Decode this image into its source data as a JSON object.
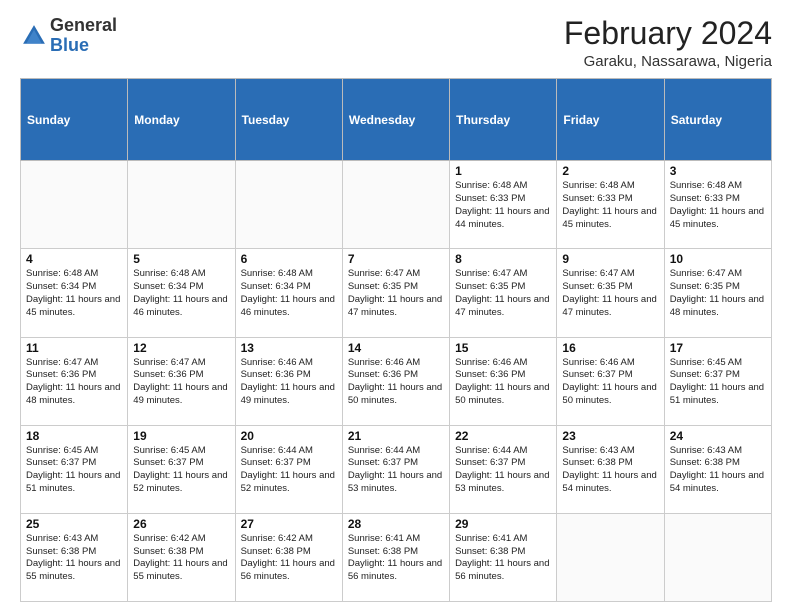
{
  "header": {
    "logo_general": "General",
    "logo_blue": "Blue",
    "month_year": "February 2024",
    "location": "Garaku, Nassarawa, Nigeria"
  },
  "days_of_week": [
    "Sunday",
    "Monday",
    "Tuesday",
    "Wednesday",
    "Thursday",
    "Friday",
    "Saturday"
  ],
  "weeks": [
    [
      {
        "num": "",
        "info": ""
      },
      {
        "num": "",
        "info": ""
      },
      {
        "num": "",
        "info": ""
      },
      {
        "num": "",
        "info": ""
      },
      {
        "num": "1",
        "info": "Sunrise: 6:48 AM\nSunset: 6:33 PM\nDaylight: 11 hours\nand 44 minutes."
      },
      {
        "num": "2",
        "info": "Sunrise: 6:48 AM\nSunset: 6:33 PM\nDaylight: 11 hours\nand 45 minutes."
      },
      {
        "num": "3",
        "info": "Sunrise: 6:48 AM\nSunset: 6:33 PM\nDaylight: 11 hours\nand 45 minutes."
      }
    ],
    [
      {
        "num": "4",
        "info": "Sunrise: 6:48 AM\nSunset: 6:34 PM\nDaylight: 11 hours\nand 45 minutes."
      },
      {
        "num": "5",
        "info": "Sunrise: 6:48 AM\nSunset: 6:34 PM\nDaylight: 11 hours\nand 46 minutes."
      },
      {
        "num": "6",
        "info": "Sunrise: 6:48 AM\nSunset: 6:34 PM\nDaylight: 11 hours\nand 46 minutes."
      },
      {
        "num": "7",
        "info": "Sunrise: 6:47 AM\nSunset: 6:35 PM\nDaylight: 11 hours\nand 47 minutes."
      },
      {
        "num": "8",
        "info": "Sunrise: 6:47 AM\nSunset: 6:35 PM\nDaylight: 11 hours\nand 47 minutes."
      },
      {
        "num": "9",
        "info": "Sunrise: 6:47 AM\nSunset: 6:35 PM\nDaylight: 11 hours\nand 47 minutes."
      },
      {
        "num": "10",
        "info": "Sunrise: 6:47 AM\nSunset: 6:35 PM\nDaylight: 11 hours\nand 48 minutes."
      }
    ],
    [
      {
        "num": "11",
        "info": "Sunrise: 6:47 AM\nSunset: 6:36 PM\nDaylight: 11 hours\nand 48 minutes."
      },
      {
        "num": "12",
        "info": "Sunrise: 6:47 AM\nSunset: 6:36 PM\nDaylight: 11 hours\nand 49 minutes."
      },
      {
        "num": "13",
        "info": "Sunrise: 6:46 AM\nSunset: 6:36 PM\nDaylight: 11 hours\nand 49 minutes."
      },
      {
        "num": "14",
        "info": "Sunrise: 6:46 AM\nSunset: 6:36 PM\nDaylight: 11 hours\nand 50 minutes."
      },
      {
        "num": "15",
        "info": "Sunrise: 6:46 AM\nSunset: 6:36 PM\nDaylight: 11 hours\nand 50 minutes."
      },
      {
        "num": "16",
        "info": "Sunrise: 6:46 AM\nSunset: 6:37 PM\nDaylight: 11 hours\nand 50 minutes."
      },
      {
        "num": "17",
        "info": "Sunrise: 6:45 AM\nSunset: 6:37 PM\nDaylight: 11 hours\nand 51 minutes."
      }
    ],
    [
      {
        "num": "18",
        "info": "Sunrise: 6:45 AM\nSunset: 6:37 PM\nDaylight: 11 hours\nand 51 minutes."
      },
      {
        "num": "19",
        "info": "Sunrise: 6:45 AM\nSunset: 6:37 PM\nDaylight: 11 hours\nand 52 minutes."
      },
      {
        "num": "20",
        "info": "Sunrise: 6:44 AM\nSunset: 6:37 PM\nDaylight: 11 hours\nand 52 minutes."
      },
      {
        "num": "21",
        "info": "Sunrise: 6:44 AM\nSunset: 6:37 PM\nDaylight: 11 hours\nand 53 minutes."
      },
      {
        "num": "22",
        "info": "Sunrise: 6:44 AM\nSunset: 6:37 PM\nDaylight: 11 hours\nand 53 minutes."
      },
      {
        "num": "23",
        "info": "Sunrise: 6:43 AM\nSunset: 6:38 PM\nDaylight: 11 hours\nand 54 minutes."
      },
      {
        "num": "24",
        "info": "Sunrise: 6:43 AM\nSunset: 6:38 PM\nDaylight: 11 hours\nand 54 minutes."
      }
    ],
    [
      {
        "num": "25",
        "info": "Sunrise: 6:43 AM\nSunset: 6:38 PM\nDaylight: 11 hours\nand 55 minutes."
      },
      {
        "num": "26",
        "info": "Sunrise: 6:42 AM\nSunset: 6:38 PM\nDaylight: 11 hours\nand 55 minutes."
      },
      {
        "num": "27",
        "info": "Sunrise: 6:42 AM\nSunset: 6:38 PM\nDaylight: 11 hours\nand 56 minutes."
      },
      {
        "num": "28",
        "info": "Sunrise: 6:41 AM\nSunset: 6:38 PM\nDaylight: 11 hours\nand 56 minutes."
      },
      {
        "num": "29",
        "info": "Sunrise: 6:41 AM\nSunset: 6:38 PM\nDaylight: 11 hours\nand 56 minutes."
      },
      {
        "num": "",
        "info": ""
      },
      {
        "num": "",
        "info": ""
      }
    ]
  ]
}
